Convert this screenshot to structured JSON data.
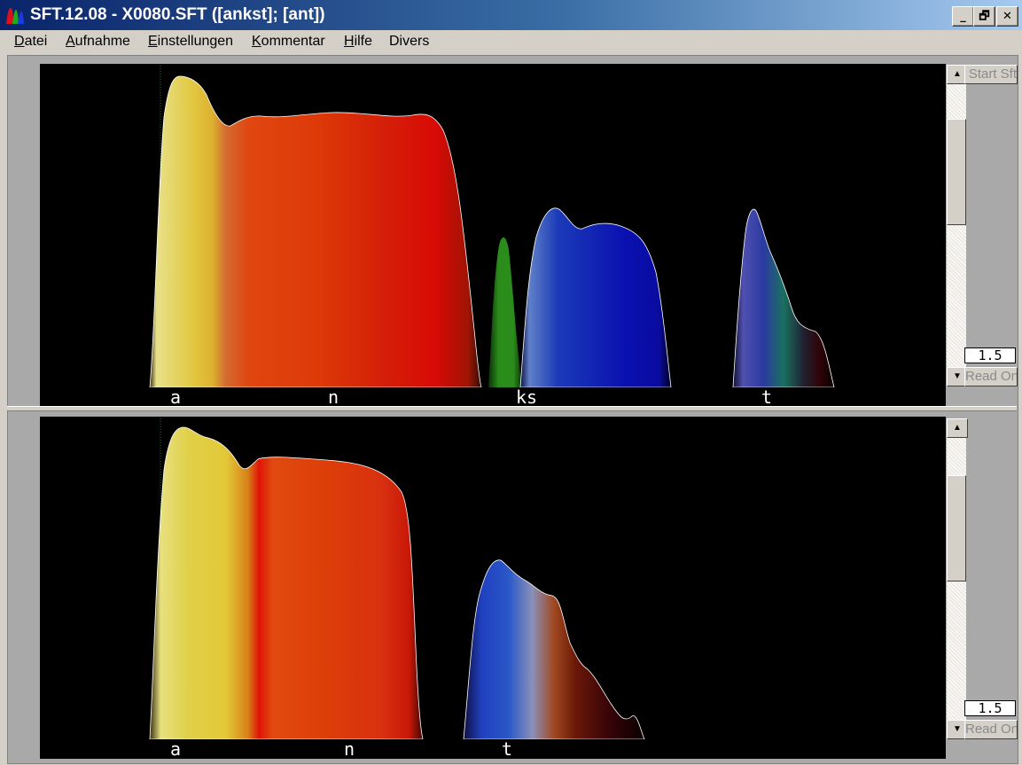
{
  "window": {
    "title": "SFT.12.08 - X0080.SFT ([ankst]; [ant])",
    "controls": {
      "minimize": "_",
      "restore": "🗗",
      "close": "✕"
    }
  },
  "menu": {
    "items": [
      {
        "label": "Datei",
        "mnemonic": "D",
        "rest": "atei"
      },
      {
        "label": "Aufnahme",
        "mnemonic": "A",
        "rest": "ufnahme"
      },
      {
        "label": "Einstellungen",
        "mnemonic": "E",
        "rest": "instellungen"
      },
      {
        "label": "Kommentar",
        "mnemonic": "K",
        "rest": "ommentar"
      },
      {
        "label": "Hilfe",
        "mnemonic": "H",
        "rest": "ilfe"
      },
      {
        "label": "Divers",
        "mnemonic": "",
        "rest": "Divers"
      }
    ]
  },
  "panels": [
    {
      "segments": [
        {
          "label": "a"
        },
        {
          "label": "n"
        },
        {
          "label": "ks"
        },
        {
          "label": "t"
        }
      ],
      "start_button": "Start Sft",
      "read_button": "Read On",
      "value": "1.5"
    },
    {
      "segments": [
        {
          "label": "a"
        },
        {
          "label": "n"
        },
        {
          "label": "t"
        }
      ],
      "read_button": "Read On",
      "value": "1.5"
    }
  ],
  "colors": {
    "vowel_yellow": "#e6d23a",
    "nasal_red": "#d81808",
    "fricative_green": "#2a8c1a",
    "plosive_blue": "#0a1aa8",
    "background": "#000000"
  }
}
